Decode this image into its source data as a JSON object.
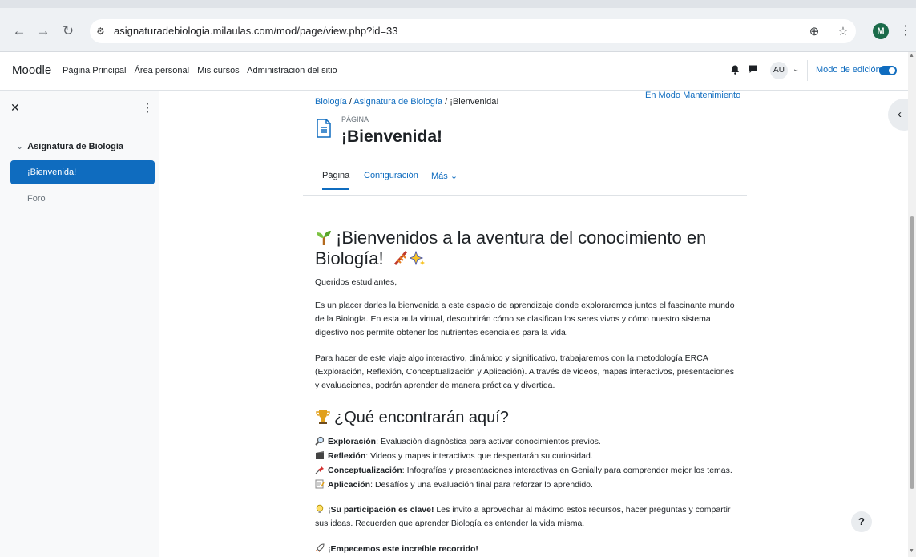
{
  "browser": {
    "url": "asignaturadebiologia.milaulas.com/mod/page/view.php?id=33",
    "profile_initial": "M"
  },
  "navbar": {
    "brand": "Moodle",
    "links": [
      "Página Principal",
      "Área personal",
      "Mis cursos",
      "Administración del sitio"
    ],
    "user_initials": "AU",
    "edit_mode_label": "Modo de edición"
  },
  "drawer": {
    "course": "Asignatura de Biología",
    "items": [
      {
        "label": "¡Bienvenida!",
        "active": true
      },
      {
        "label": "Foro",
        "active": false
      }
    ]
  },
  "header": {
    "breadcrumb": [
      "Biología",
      "Asignatura de Biología",
      "¡Bienvenida!"
    ],
    "maintenance": "En Modo Mantenimiento",
    "kind": "PÁGINA",
    "title": "¡Bienvenida!",
    "tabs": [
      "Página",
      "Configuración",
      "Más"
    ]
  },
  "content": {
    "heading1": "¡Bienvenidos a la aventura del conocimiento en Biología!",
    "greeting": "Queridos estudiantes,",
    "para1": "Es un placer darles la bienvenida a este espacio de aprendizaje donde exploraremos juntos el fascinante mundo de la Biología. En esta aula virtual, descubrirán cómo se clasifican los seres vivos y cómo nuestro sistema digestivo nos permite obtener los nutrientes esenciales para la vida.",
    "para2": "Para hacer de este viaje algo interactivo, dinámico y significativo, trabajaremos con la metodología ERCA (Exploración, Reflexión, Conceptualización y Aplicación). A través de videos, mapas interactivos, presentaciones y evaluaciones, podrán aprender de manera práctica y divertida.",
    "heading2": "¿Qué encontrarán aquí?",
    "list": [
      {
        "term": "Exploración",
        "text": ": Evaluación diagnóstica para activar conocimientos previos."
      },
      {
        "term": "Reflexión",
        "text": ": Videos y mapas interactivos que despertarán su curiosidad."
      },
      {
        "term": "Conceptualización",
        "text": ": Infografías y presentaciones interactivas en Genially para comprender mejor los temas."
      },
      {
        "term": "Aplicación",
        "text": ": Desafíos y una evaluación final para reforzar lo aprendido."
      }
    ],
    "participation_bold": "¡Su participación es clave!",
    "participation_text": " Les invito a aprovechar al máximo estos recursos, hacer preguntas y compartir sus ideas. Recuerden que aprender Biología es entender la vida misma.",
    "closing": "¡Empecemos este increíble recorrido!"
  },
  "help_label": "?"
}
